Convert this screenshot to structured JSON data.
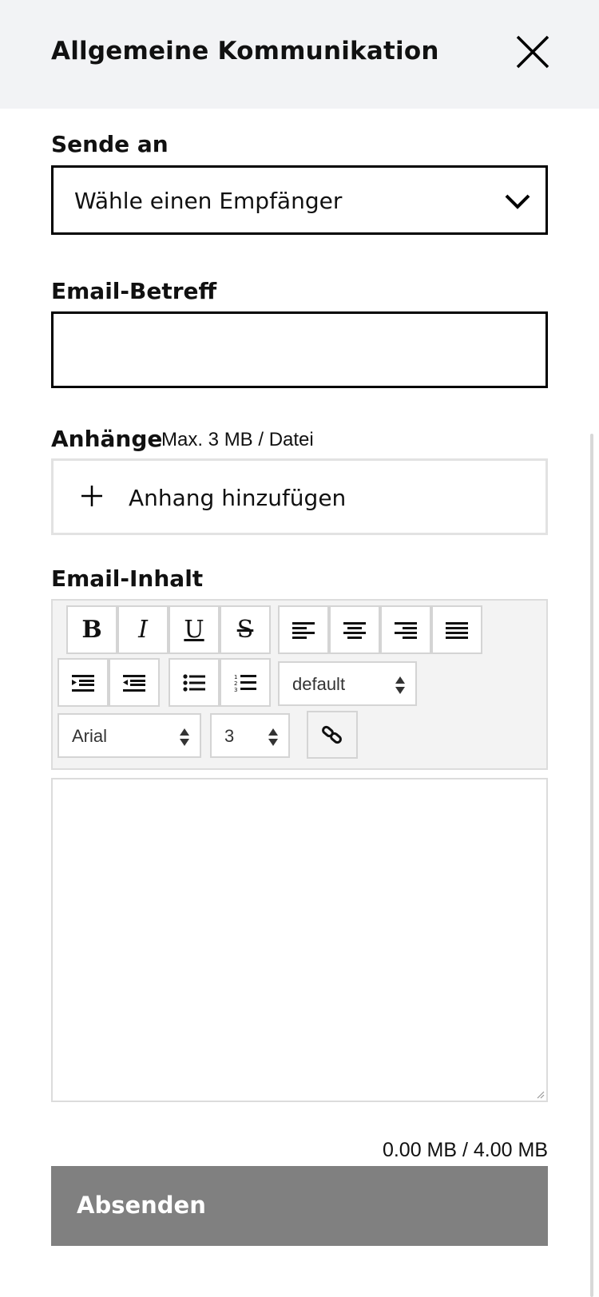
{
  "header": {
    "title": "Allgemeine Kommunikation",
    "close_icon": "close-icon"
  },
  "recipient": {
    "label": "Sende an",
    "value": "Wähle einen Empfänger",
    "icon": "chevron-down-icon"
  },
  "subject": {
    "label": "Email-Betreff",
    "value": ""
  },
  "attachments": {
    "label": "Anhänge",
    "hint": "Max. 3 MB / Datei",
    "add_label": "Anhang hinzufügen",
    "add_icon": "plus-icon"
  },
  "content": {
    "label": "Email-Inhalt",
    "toolbar": {
      "bold": "B",
      "italic": "I",
      "underline": "U",
      "strikethrough": "S",
      "format_value": "default",
      "font_value": "Arial",
      "size_value": "3"
    },
    "body": ""
  },
  "size_info": "0.00 MB / 4.00 MB",
  "submit_label": "Absenden"
}
